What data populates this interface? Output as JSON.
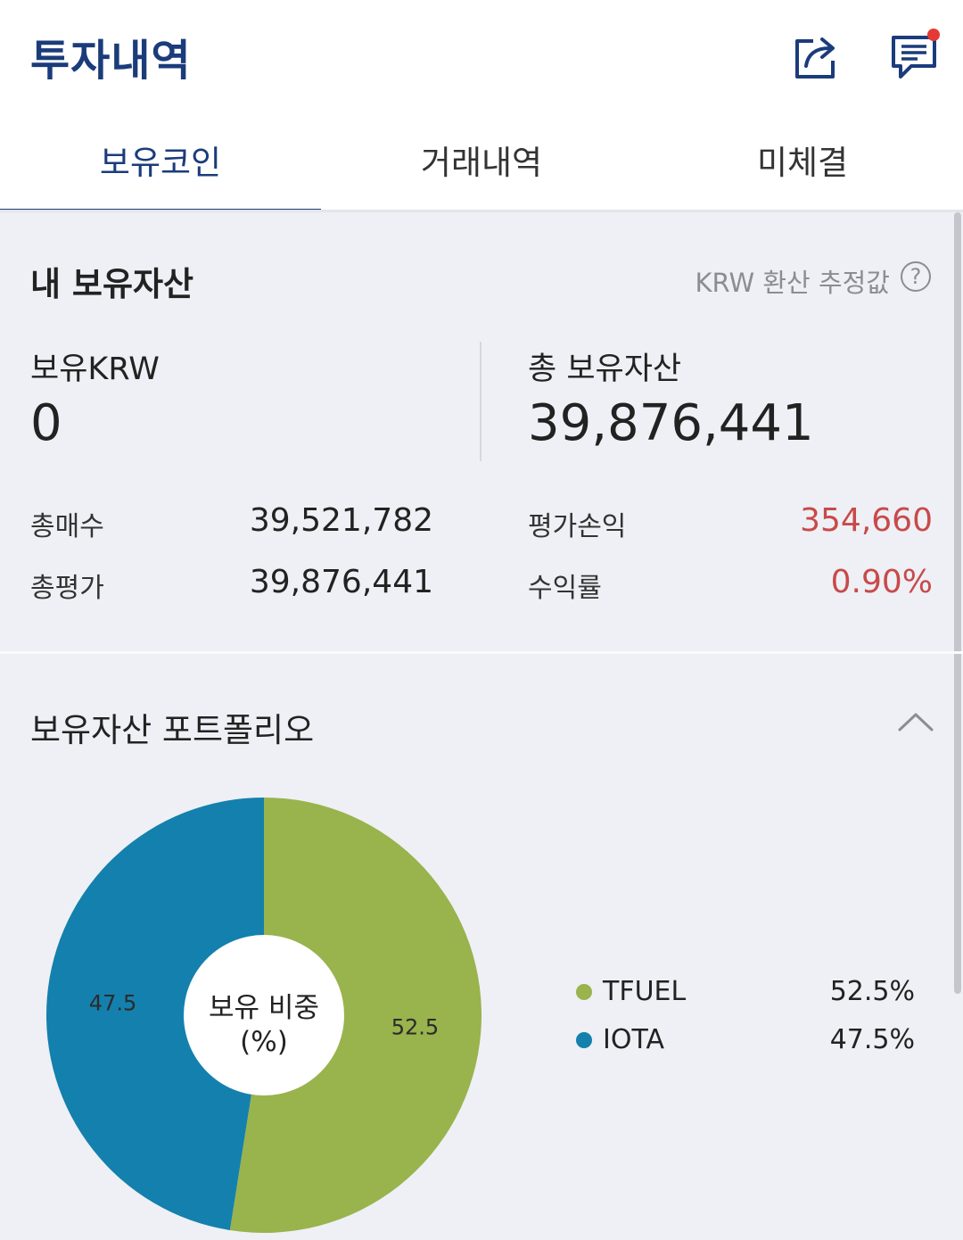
{
  "app_title": "투자내역",
  "header": {
    "share_icon": "share-icon",
    "chat_icon": "chat-icon"
  },
  "tabs": [
    {
      "label": "보유코인",
      "active": true
    },
    {
      "label": "거래내역",
      "active": false
    },
    {
      "label": "미체결",
      "active": false
    }
  ],
  "assets": {
    "title": "내 보유자산",
    "krw_note": "KRW 환산 추정값",
    "help_symbol": "?",
    "held_krw_label": "보유KRW",
    "held_krw_value": "0",
    "total_assets_label": "총 보유자산",
    "total_assets_value": "39,876,441",
    "total_buy_label": "총매수",
    "total_buy_value": "39,521,782",
    "total_eval_label": "총평가",
    "total_eval_value": "39,876,441",
    "pnl_label": "평가손익",
    "pnl_value": "354,660",
    "return_label": "수익률",
    "return_value": "0.90%",
    "positive_color": "#c84a4a"
  },
  "portfolio": {
    "title": "보유자산 포트폴리오",
    "center_line1": "보유 비중",
    "center_line2": "(%)",
    "legend": [
      {
        "name": "TFUEL",
        "pct": "52.5%",
        "color": "#99b34d"
      },
      {
        "name": "IOTA",
        "pct": "47.5%",
        "color": "#1480ad"
      }
    ]
  },
  "chart_data": {
    "type": "pie",
    "categories": [
      "TFUEL",
      "IOTA"
    ],
    "values": [
      52.5,
      47.5
    ],
    "data_labels": [
      "52.5",
      "47.5"
    ],
    "colors": [
      "#99b34d",
      "#1480ad"
    ],
    "donut": true,
    "legend": "right"
  }
}
